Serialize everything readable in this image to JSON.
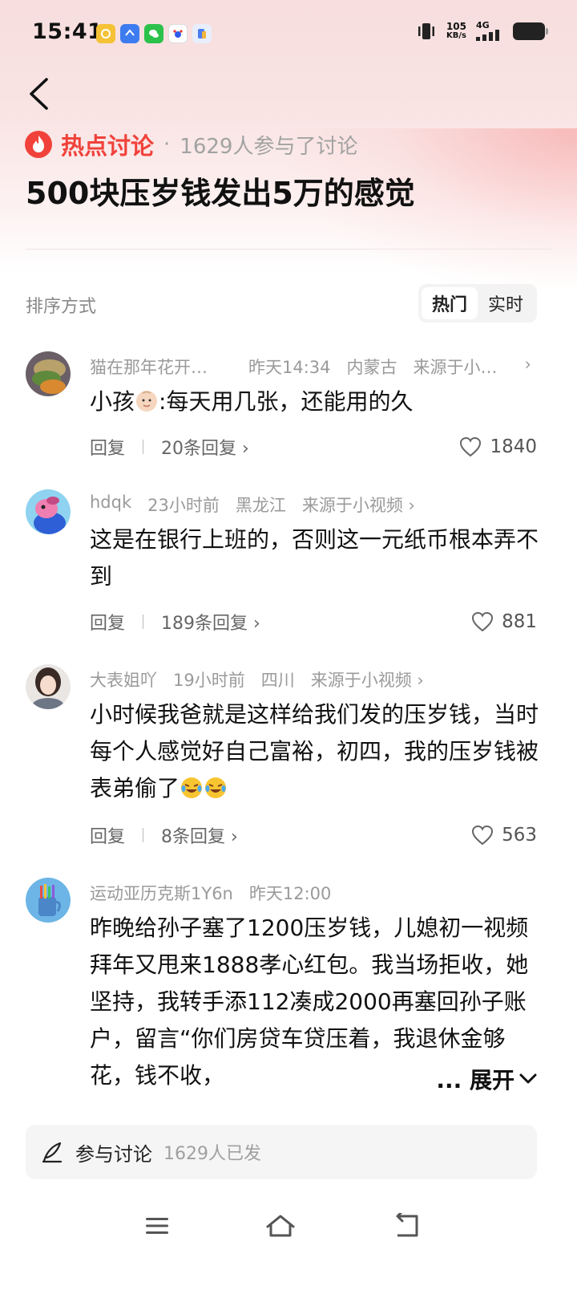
{
  "status_bar": {
    "time": "15:41",
    "speed_value": "105",
    "speed_unit": "KB/s",
    "network": "4G",
    "app_icons": [
      "yellow-app-icon",
      "blue-app-icon",
      "wechat-icon",
      "baidu-icon",
      "files-icon"
    ]
  },
  "topic": {
    "tag": "热点讨论",
    "dot": "·",
    "participants": "1629人参与了讨论",
    "title": "500块压岁钱发出5万的感觉"
  },
  "sort": {
    "label": "排序方式",
    "options": [
      "热门",
      "实时"
    ],
    "active": "热门"
  },
  "comments": [
    {
      "user": "猫在那年花开…",
      "time": "昨天14:34",
      "location": "内蒙古",
      "source": "来源于小…",
      "text_before_emoji": "小孩",
      "text_after_emoji": ":每天用几张，还能用的久",
      "reply": "回复",
      "reply_count": "20条回复",
      "likes": "1840"
    },
    {
      "user": "hdqk",
      "time": "23小时前",
      "location": "黑龙江",
      "source": "来源于小视频",
      "text": "这是在银行上班的，否则这一元纸币根本弄不到",
      "reply": "回复",
      "reply_count": "189条回复",
      "likes": "881"
    },
    {
      "user": "大表姐吖",
      "time": "19小时前",
      "location": "四川",
      "source": "来源于小视频",
      "text": "小时候我爸就是这样给我们发的压岁钱，当时每个人感觉好自己富裕，初四，我的压岁钱被表弟偷了",
      "reply": "回复",
      "reply_count": "8条回复",
      "likes": "563"
    },
    {
      "user": "运动亚历克斯1Y6n",
      "time": "昨天12:00",
      "text": "昨晚给孙子塞了1200压岁钱，儿媳初一视频拜年又甩来1888孝心红包。我当场拒收，她坚持，我转手添112凑成2000再塞回孙子账户，留言“你们房贷车贷压着，我退休金够花，钱不收，",
      "expand": "... 展开"
    }
  ],
  "join_bar": {
    "label": "参与讨论",
    "count": "1629人已发"
  },
  "colors": {
    "accent_red": "#f0423b",
    "meta_gray": "#9a9a9a",
    "header_pink": "#f8dede"
  }
}
